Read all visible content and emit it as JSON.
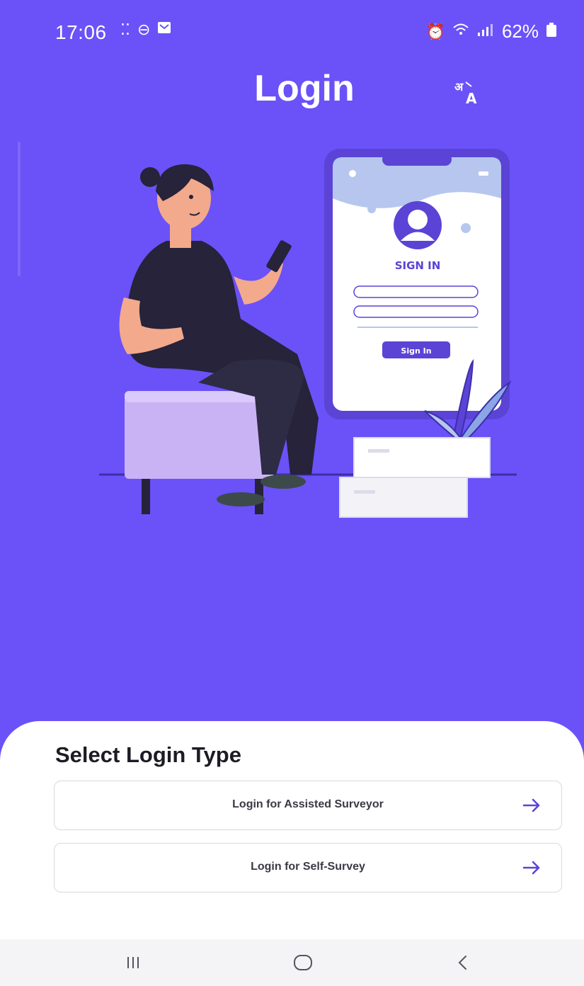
{
  "status_bar": {
    "time": "17:06",
    "battery": "62%",
    "icons_left": [
      "dots-icon",
      "minus-circle-icon",
      "message-icon"
    ],
    "icons_right": [
      "alarm-icon",
      "wifi-icon",
      "signal-icon",
      "battery-icon"
    ]
  },
  "header": {
    "title": "Login",
    "translate_icon": "translate-icon"
  },
  "illustration": {
    "phone_heading": "SIGN IN",
    "phone_button": "Sign In"
  },
  "login_sheet": {
    "title": "Select Login Type",
    "options": [
      {
        "label": "Login for Assisted Surveyor",
        "icon": "arrow-right-icon"
      },
      {
        "label": "Login for Self-Survey",
        "icon": "arrow-right-icon"
      }
    ]
  },
  "nav_bar": {
    "buttons": [
      "recents-icon",
      "home-icon",
      "back-icon"
    ]
  },
  "colors": {
    "background": "#6a52f8",
    "accent": "#5b43d6",
    "sheet": "#ffffff"
  }
}
